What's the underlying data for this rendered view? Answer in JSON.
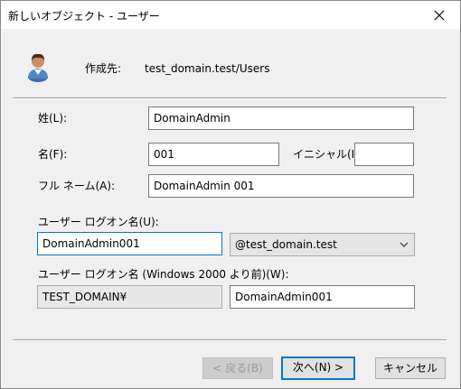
{
  "window": {
    "title": "新しいオブジェクト - ユーザー"
  },
  "header": {
    "create_in_label": "作成先:",
    "create_in_value": "test_domain.test/Users"
  },
  "form": {
    "last_name_label": "姓(L):",
    "last_name_value": "DomainAdmin",
    "first_name_label": "名(F):",
    "first_name_value": "001",
    "initials_label": "イニシャル(I):",
    "initials_value": "",
    "full_name_label": "フル ネーム(A):",
    "full_name_value": "DomainAdmin 001",
    "logon_name_label": "ユーザー ログオン名(U):",
    "logon_name_value": "DomainAdmin001",
    "upn_suffix_value": "@test_domain.test",
    "pre2000_label": "ユーザー ログオン名 (Windows 2000 より前)(W):",
    "pre2000_domain_value": "TEST_DOMAIN¥",
    "pre2000_name_value": "DomainAdmin001"
  },
  "buttons": {
    "back_label": "< 戻る(B)",
    "next_label": "次へ(N) >",
    "cancel_label": "キャンセル"
  },
  "icons": {
    "close": "close-icon",
    "user": "user-icon",
    "dropdown": "chevron-down-icon"
  },
  "colors": {
    "focus_accent": "#0078d7",
    "dialog_bg": "#f0f0f0"
  }
}
